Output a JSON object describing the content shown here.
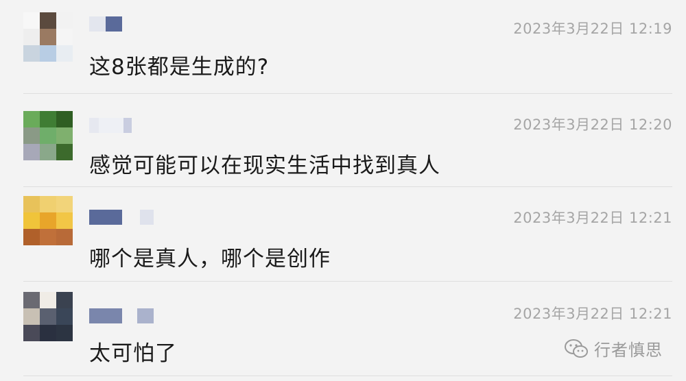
{
  "messages": [
    {
      "timestamp": "2023年3月22日 12:19",
      "text": "这8张都是生成的?"
    },
    {
      "timestamp": "2023年3月22日 12:20",
      "text": "感觉可能可以在现实生活中找到真人"
    },
    {
      "timestamp": "2023年3月22日 12:21",
      "text": "哪个是真人，哪个是创作"
    },
    {
      "timestamp": "2023年3月22日 12:21",
      "text": "太可怕了"
    }
  ],
  "watermark": {
    "text": "行者慎思",
    "icon": "wechat-icon"
  },
  "colors": {
    "background": "#f3f3f3",
    "timestamp": "#a5a5a5",
    "message_text": "#1a1a1a",
    "divider": "#dedede"
  }
}
